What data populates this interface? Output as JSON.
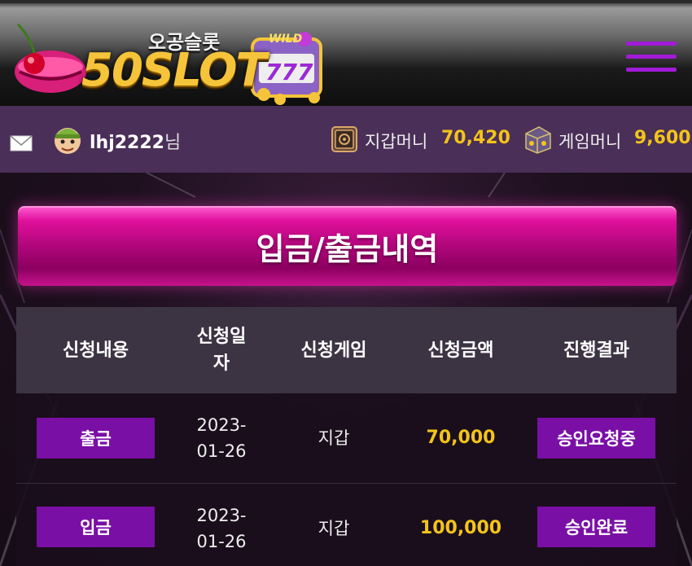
{
  "header": {
    "logo_title": "50SLOT",
    "logo_subtitle": "오공슬롯",
    "menu_icon": "hamburger-menu-icon"
  },
  "userbar": {
    "mail_icon": "mail-icon",
    "username": "lhj2222",
    "username_suffix": "님",
    "wallet_label": "지갑머니",
    "wallet_value": "70,420",
    "game_label": "게임머니",
    "game_value": "9,600"
  },
  "page": {
    "title": "입금/출금내역"
  },
  "table": {
    "headers": [
      "신청내용",
      "신청일자",
      "신청게임",
      "신청금액",
      "진행결과"
    ],
    "rows": [
      {
        "type": "출금",
        "date": "2023-01-26",
        "game": "지갑",
        "amount": "70,000",
        "status": "승인요청중"
      },
      {
        "type": "입금",
        "date": "2023-01-26",
        "game": "지갑",
        "amount": "100,000",
        "status": "승인완료"
      }
    ]
  },
  "colors": {
    "accent_purple": "#7a0fa6",
    "banner_magenta": "#c8128c",
    "gold": "#f3c419",
    "userbar": "#4a2f58"
  }
}
